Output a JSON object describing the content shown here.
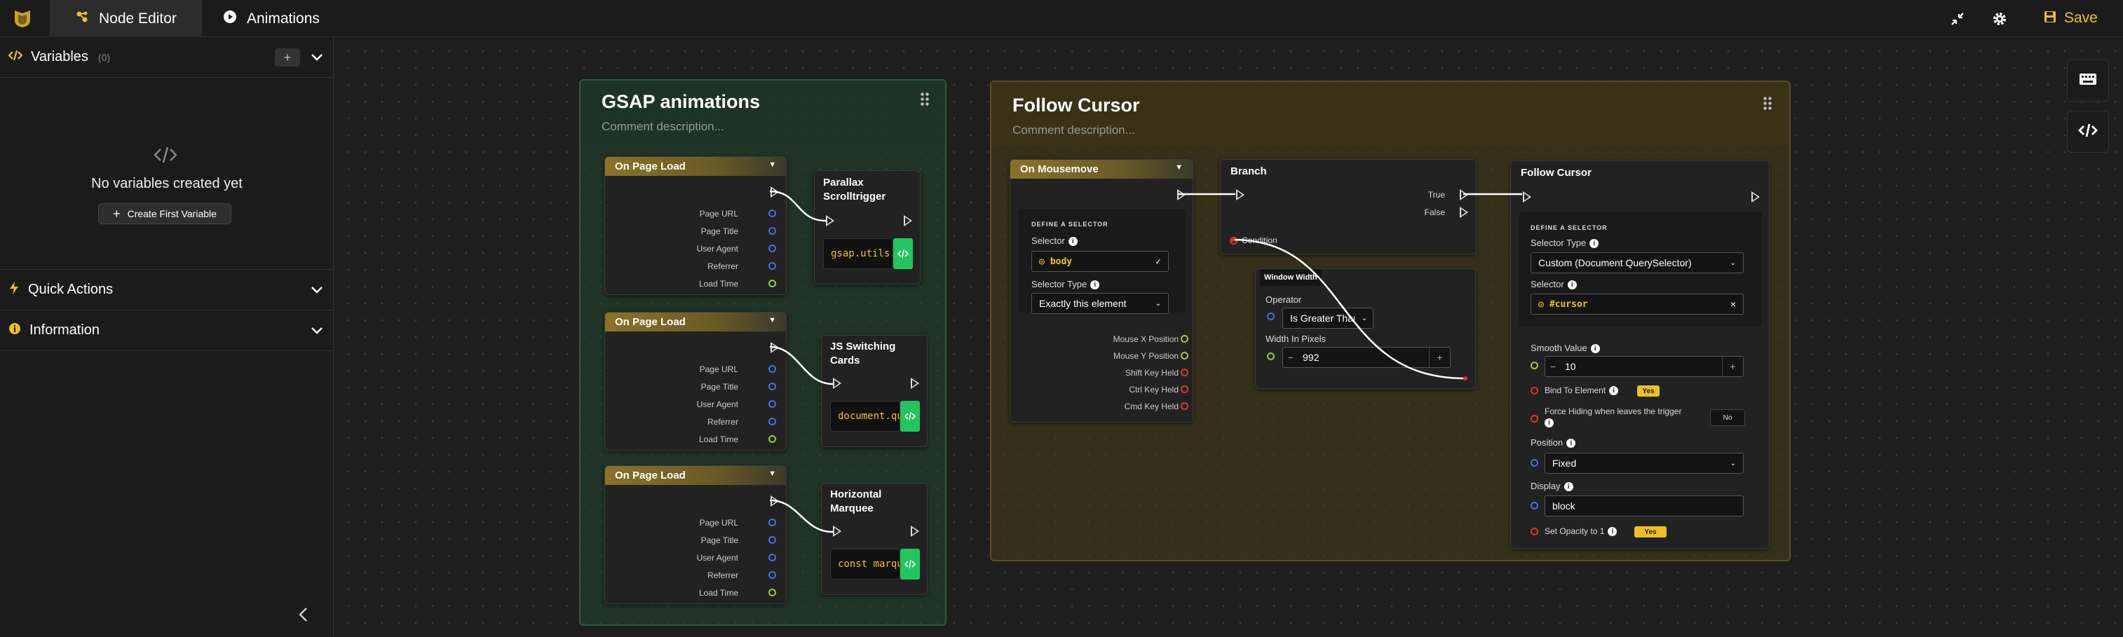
{
  "topbar": {
    "tabs": [
      {
        "label": "Node Editor",
        "icon": "nodes-icon"
      },
      {
        "label": "Animations",
        "icon": "play-circle-icon"
      }
    ],
    "save_label": "Save"
  },
  "sidebar": {
    "variables_title": "Variables",
    "variables_count": "(0)",
    "empty_text": "No variables created yet",
    "create_button": "Create First Variable",
    "quick_actions": "Quick Actions",
    "information": "Information"
  },
  "groups": {
    "gsap": {
      "title": "GSAP animations",
      "desc": "Comment description..."
    },
    "follow": {
      "title": "Follow Cursor",
      "desc": "Comment description..."
    }
  },
  "page_load_node": {
    "title": "On Page Load",
    "outputs": [
      "Page URL",
      "Page Title",
      "User Agent",
      "Referrer",
      "Load Time"
    ]
  },
  "code_nodes": [
    {
      "title": "Parallax Scrolltrigger",
      "code": "gsap.utils."
    },
    {
      "title": "JS Switching Cards",
      "code": "document.qu"
    },
    {
      "title": "Horizontal Marquee",
      "code": "const marqu"
    }
  ],
  "mousemove": {
    "title": "On Mousemove",
    "section": "DEFINE A SELECTOR",
    "selector_label": "Selector",
    "selector_value": "body",
    "type_label": "Selector Type",
    "type_value": "Exactly this element",
    "outputs": [
      "Mouse X Position",
      "Mouse Y Position",
      "Shift Key Held",
      "Ctrl Key Held",
      "Cmd Key Held"
    ]
  },
  "branch": {
    "title": "Branch",
    "true_label": "True",
    "false_label": "False",
    "condition_label": "Condition"
  },
  "window_width": {
    "title": "Window Width",
    "operator_label": "Operator",
    "operator_value": "Is Greater Than",
    "width_label": "Width In Pixels",
    "width_value": "992"
  },
  "follow_node": {
    "title": "Follow Cursor",
    "section": "DEFINE A SELECTOR",
    "type_label": "Selector Type",
    "type_value": "Custom (Document QuerySelector)",
    "selector_label": "Selector",
    "selector_value": "#cursor",
    "smooth_label": "Smooth Value",
    "smooth_value": "10",
    "bind_label": "Bind To Element",
    "bind_value": "Yes",
    "force_label": "Force Hiding when leaves the trigger",
    "force_value": "No",
    "position_label": "Position",
    "position_value": "Fixed",
    "display_label": "Display",
    "display_value": "block",
    "opacity_label": "Set Opacity to 1",
    "opacity_value": "Yes"
  }
}
